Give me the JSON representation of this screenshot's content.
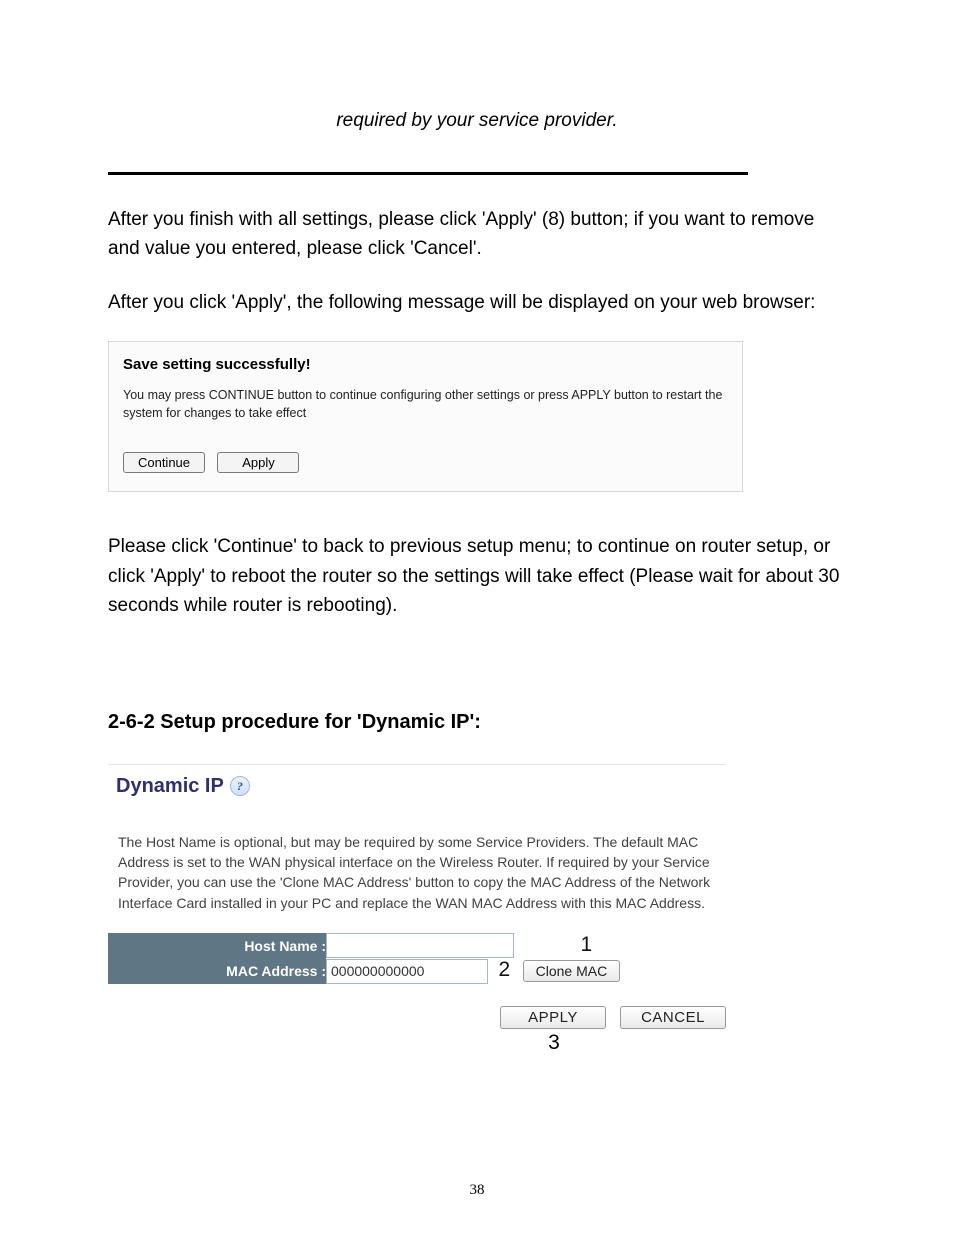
{
  "top_italic": "required by your service provider.",
  "para1": "After you finish with all settings, please click 'Apply' (8) button; if you want to remove and value you entered, please click 'Cancel'.",
  "para2": "After you click 'Apply', the following message will be displayed on your web browser:",
  "msgbox": {
    "title": "Save setting successfully!",
    "desc": "You may press CONTINUE button to continue configuring other settings or press APPLY button to restart the system for changes to take effect",
    "continue_label": "Continue",
    "apply_label": "Apply"
  },
  "para3": "Please click 'Continue' to back to previous setup menu; to continue on router setup, or click 'Apply' to reboot the router so the settings will take effect (Please wait for about 30 seconds while router is rebooting).",
  "section_heading": "2-6-2 Setup procedure for 'Dynamic IP':",
  "dyn": {
    "title": "Dynamic IP",
    "help_symbol": "?",
    "desc": "The Host Name is optional, but may be required by some Service Providers. The default MAC Address is set to the WAN physical interface on the Wireless Router. If required by your Service Provider, you can use the 'Clone MAC Address' button to copy the MAC Address of the Network Interface Card installed in your PC and replace the WAN MAC Address with this MAC Address.",
    "host_label": "Host Name :",
    "mac_label": "MAC Address :",
    "host_value": "",
    "mac_value": "000000000000",
    "clone_label": "Clone MAC",
    "apply_label": "APPLY",
    "cancel_label": "CANCEL",
    "annot1": "1",
    "annot2": "2",
    "annot3": "3"
  },
  "page_number": "38"
}
